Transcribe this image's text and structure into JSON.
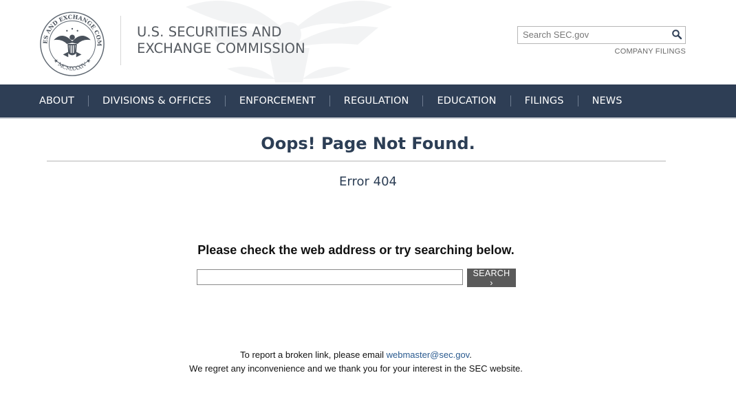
{
  "header": {
    "agency_line1": "U.S. SECURITIES AND",
    "agency_line2": "EXCHANGE COMMISSION",
    "search_placeholder": "Search SEC.gov",
    "company_filings_label": "COMPANY FILINGS"
  },
  "nav": {
    "items": [
      {
        "label": "ABOUT"
      },
      {
        "label": "DIVISIONS & OFFICES"
      },
      {
        "label": "ENFORCEMENT"
      },
      {
        "label": "REGULATION"
      },
      {
        "label": "EDUCATION"
      },
      {
        "label": "FILINGS"
      },
      {
        "label": "NEWS"
      }
    ]
  },
  "main": {
    "title": "Oops! Page Not Found.",
    "error_code": "Error 404",
    "instruction": "Please check the web address or try searching below.",
    "search_value": "",
    "search_button_label": "SEARCH ›"
  },
  "footer": {
    "report_prefix": "To report a broken link, please email ",
    "email": "webmaster@sec.gov",
    "report_suffix": ".",
    "regret": "We regret any inconvenience and we thank you for your interest in the SEC website."
  },
  "colors": {
    "nav_bg": "#2e3e55",
    "title": "#2c3e55",
    "link": "#2a5a8f"
  },
  "icons": [
    "sec-seal-logo",
    "eagle-watermark",
    "search-icon"
  ]
}
